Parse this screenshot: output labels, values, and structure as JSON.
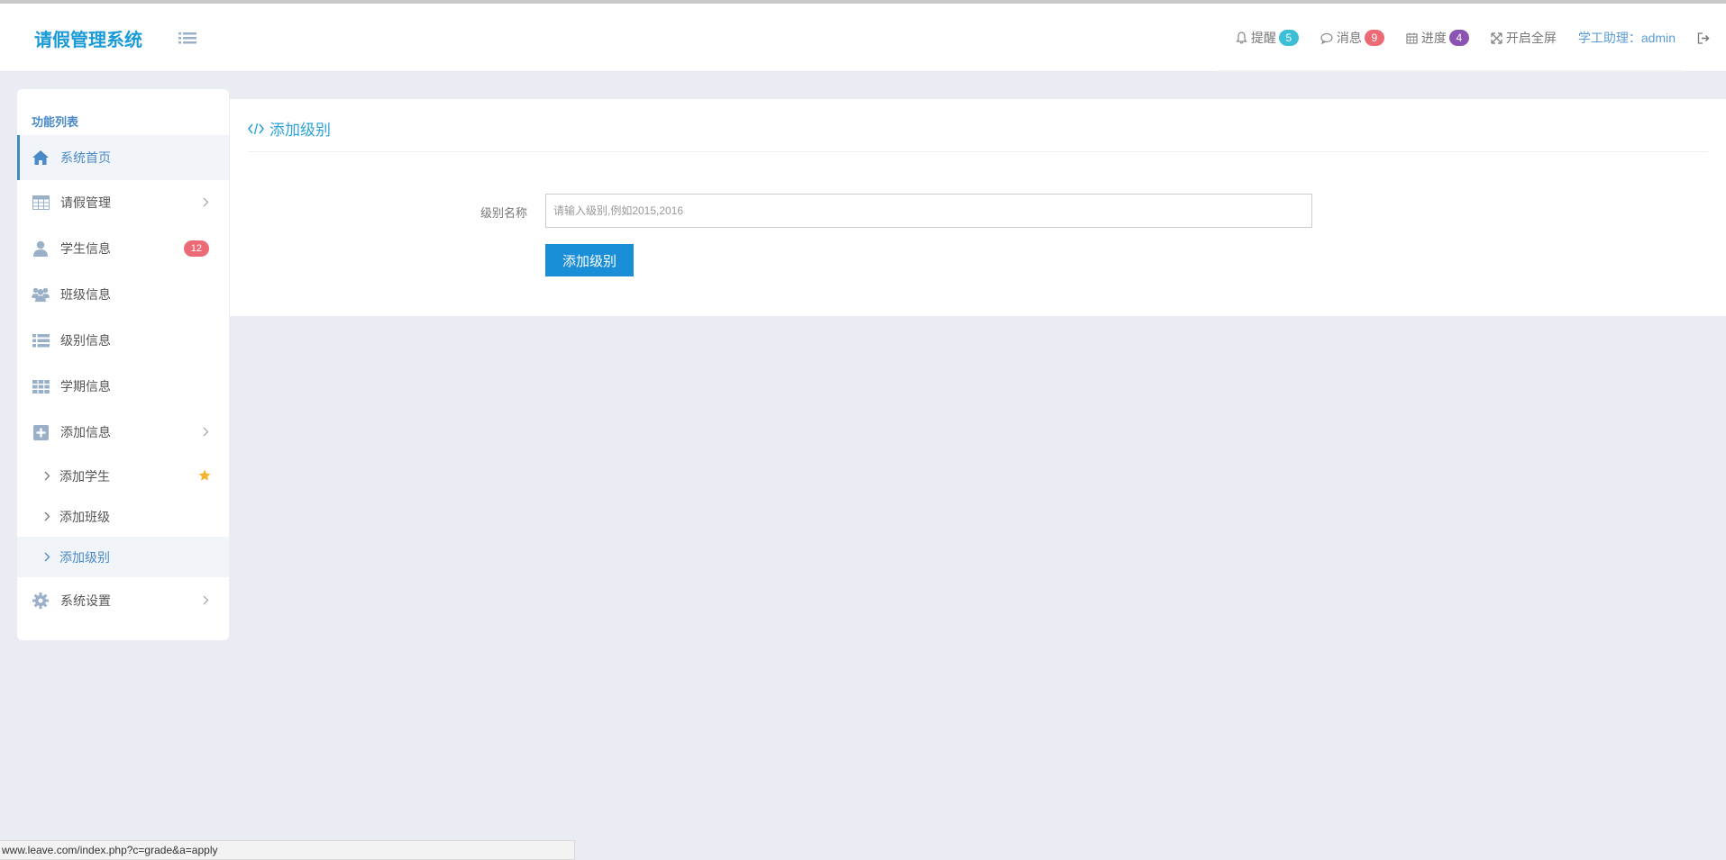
{
  "header": {
    "brand": "请假管理系统",
    "nav": {
      "remind_label": "提醒",
      "remind_count": "5",
      "message_label": "消息",
      "message_count": "9",
      "progress_label": "进度",
      "progress_count": "4",
      "fullscreen_label": "开启全屏",
      "user_label": "学工助理：admin"
    },
    "colors": {
      "remind": "#3bbfd6",
      "message": "#ec6a76",
      "progress": "#8b54b3",
      "brand": "#1a9bd7"
    }
  },
  "sidebar": {
    "title": "功能列表",
    "items": [
      {
        "label": "系统首页",
        "icon": "home-icon"
      },
      {
        "label": "请假管理",
        "icon": "table-icon"
      },
      {
        "label": "学生信息",
        "icon": "user-icon",
        "badge": "12"
      },
      {
        "label": "班级信息",
        "icon": "users-icon"
      },
      {
        "label": "级别信息",
        "icon": "list-icon"
      },
      {
        "label": "学期信息",
        "icon": "grid-icon"
      },
      {
        "label": "添加信息",
        "icon": "plus-square-icon"
      },
      {
        "label": "系统设置",
        "icon": "gear-icon"
      }
    ],
    "subitems": [
      {
        "label": "添加学生"
      },
      {
        "label": "添加班级"
      },
      {
        "label": "添加级别"
      }
    ]
  },
  "main": {
    "title": "添加级别",
    "form": {
      "level_label": "级别名称",
      "level_placeholder": "请输入级别,例如2015,2016",
      "level_value": "",
      "submit_label": "添加级别"
    }
  },
  "statusbar": {
    "url": "www.leave.com/index.php?c=grade&a=apply"
  }
}
